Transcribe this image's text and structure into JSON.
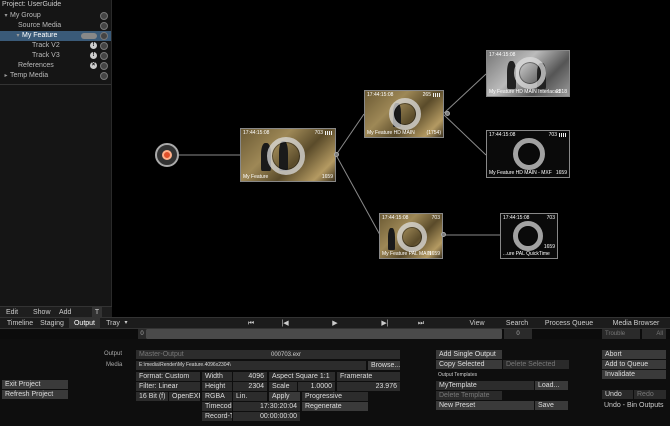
{
  "project": {
    "title": "Project: UserGuide",
    "tree": [
      {
        "label": "My Group",
        "indent": 0,
        "tri": "▾",
        "selected": false
      },
      {
        "label": "Source Media",
        "indent": 1,
        "tri": "",
        "selected": false
      },
      {
        "label": "My Feature",
        "indent": 1,
        "tri": "▾",
        "selected": true
      },
      {
        "label": "Track V2",
        "indent": 2,
        "tri": "",
        "selected": false
      },
      {
        "label": "Track V3",
        "indent": 2,
        "tri": "",
        "selected": false
      },
      {
        "label": "References",
        "indent": 1,
        "tri": "",
        "selected": false
      },
      {
        "label": "Temp Media",
        "indent": 0,
        "tri": "▸",
        "selected": false
      }
    ],
    "toolbar": {
      "edit": "Edit",
      "show": "Show",
      "add": "Add",
      "trash": "T"
    }
  },
  "tabs": {
    "timeline": "Timeline",
    "staging": "Staging",
    "output": "Output",
    "tray": "Tray",
    "tray_arrow": "▾",
    "view": "View",
    "search": "Search",
    "process_queue": "Process Queue",
    "media_browser": "Media Browser"
  },
  "transport": {
    "prev_mark": "⏮",
    "step_back": "|◀",
    "play": "▶",
    "step_fwd": "▶|",
    "next_mark": "⏭",
    "in_value": "0",
    "out_value": "0",
    "trouble": "Trouble",
    "all": "All"
  },
  "graph": {
    "source_icon": "media-source-icon",
    "nodes": {
      "feature": {
        "tc": "17:44:15:08",
        "frames": "703",
        "name": "My Feature",
        "count": "1659"
      },
      "hd_main": {
        "tc": "17:44:15:08",
        "frames": "265",
        "name": "My Feature HD MAIN",
        "count": "(1754)"
      },
      "pal_main": {
        "tc": "17:44:15:08",
        "frames": "703",
        "name": "My Feature PAL MAIN",
        "count": "1659"
      },
      "hd_interlaced": {
        "tc": "17:44:15:08",
        "frames": "",
        "name": "My Feature HD MAIN Interlaced",
        "count": "2318"
      },
      "hd_mxf": {
        "tc": "17:44:15:08",
        "frames": "703",
        "name": "My Feature HD MAIN - MXF",
        "count": "1659"
      },
      "pal_qt": {
        "tc": "17:44:15:08",
        "frames": "703",
        "name": "...ure PAL QuickTime",
        "count": "1659"
      }
    }
  },
  "output": {
    "output_label": "Output",
    "media_label": "Media",
    "output_name": "Master-Output",
    "filename": "000703.exr",
    "path": "E:\\media\\Render\\My Feature.4096x2304\\",
    "browse": "Browse...",
    "format": "Format: Custom",
    "filter": "Filter: Linear",
    "bitdepth": "16 Bit (f)",
    "codec": "OpenEXR",
    "width_label": "Width",
    "width_value": "4096",
    "height_label": "Height",
    "height_value": "2304",
    "rgba": "RGBA",
    "lin": "Lin.",
    "timecode_label": "Timecode",
    "timecode_value": "17:30:20:04",
    "record_tc_label": "Record-TC",
    "record_tc_value": "00:00:00:00",
    "aspect": "Aspect Square 1:1",
    "scale_label": "Scale",
    "scale_value": "1.0000",
    "apply": "Apply",
    "framerate_label": "Framerate",
    "framerate_value": "23.976",
    "progressive": "Progressive",
    "regenerate": "Regenerate",
    "exit_project": "Exit Project",
    "refresh_project": "Refresh Project"
  },
  "actions": {
    "add_single_output": "Add Single Output",
    "copy_selected": "Copy Selected",
    "delete_selected": "Delete Selected",
    "output_templates": "Output Templates",
    "template_name": "MyTemplate",
    "load": "Load...",
    "delete_template": "Delete Template",
    "new_preset": "New Preset",
    "save": "Save",
    "abort": "Abort",
    "add_to_queue": "Add to Queue",
    "invalidate": "Invalidate",
    "undo": "Undo",
    "redo": "Redo",
    "undo_status": "Undo - Bin Outputs"
  },
  "colors": {
    "selection": "#3a5a78",
    "background": "#000000"
  }
}
